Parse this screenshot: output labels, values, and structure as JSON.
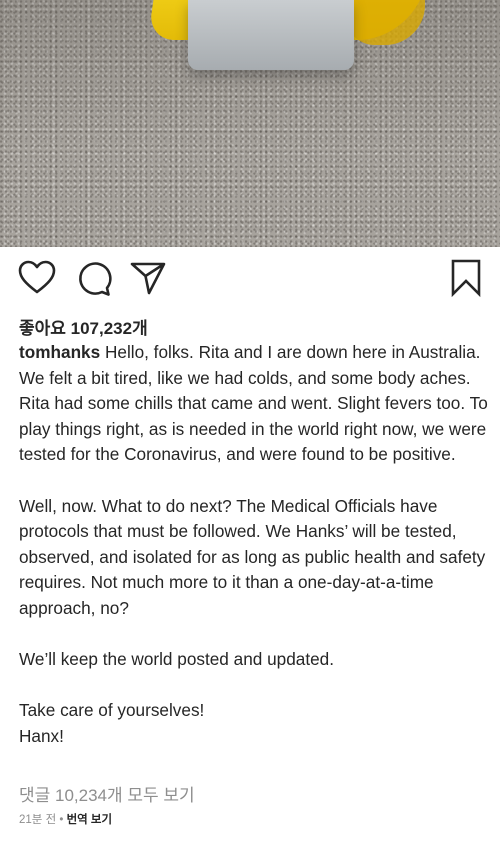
{
  "post": {
    "likes_text": "좋아요 107,232개",
    "username": "tomhanks",
    "caption": [
      "Hello, folks. Rita and I are down here in Australia. We felt a bit tired, like we had colds, and some body aches. Rita had some chills that came and went. Slight fevers too. To play things right, as is needed in the world right now,  we were tested for the Coronavirus, and were found to be positive.",
      "Well, now. What to do next? The Medical Officials have protocols that must be followed. We Hanks’ will be tested, observed, and isolated for as long as public health and safety requires.  Not much more to it than a one-day-at-a-time approach, no?",
      "We’ll keep the world posted and updated.",
      "Take care of yourselves!",
      "Hanx!"
    ],
    "comments_link": "댓글 10,234개 모두 보기",
    "time_ago": "21분 전",
    "separator": " • ",
    "translate_label": "번역 보기"
  },
  "icons": {
    "like": "heart-icon",
    "comment": "comment-icon",
    "share": "send-icon",
    "save": "bookmark-icon"
  }
}
